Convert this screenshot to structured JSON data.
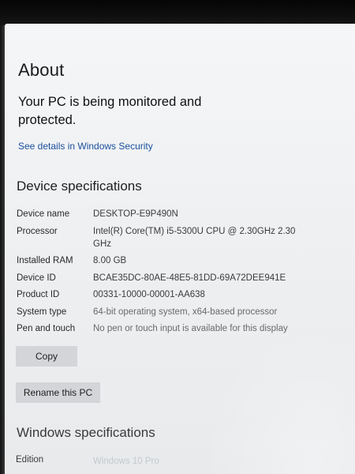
{
  "page": {
    "title": "About",
    "monitored_text": "Your PC is being monitored and protected.",
    "security_link": "See details in Windows Security"
  },
  "device_specs": {
    "heading": "Device specifications",
    "rows": [
      {
        "label": "Device name",
        "value": "DESKTOP-E9P490N"
      },
      {
        "label": "Processor",
        "value": "Intel(R) Core(TM) i5-5300U CPU @ 2.30GHz   2.30 GHz"
      },
      {
        "label": "Installed RAM",
        "value": "8.00 GB"
      },
      {
        "label": "Device ID",
        "value": "BCAE35DC-80AE-48E5-81DD-69A72DEE941E"
      },
      {
        "label": "Product ID",
        "value": "00331-10000-00001-AA638"
      },
      {
        "label": "System type",
        "value": "64-bit operating system, x64-based processor"
      },
      {
        "label": "Pen and touch",
        "value": "No pen or touch input is available for this display"
      }
    ],
    "copy_button": "Copy",
    "rename_button": "Rename this PC"
  },
  "windows_specs": {
    "heading": "Windows specifications",
    "edition_label": "Edition",
    "edition_value": "Windows 10 Pro"
  }
}
